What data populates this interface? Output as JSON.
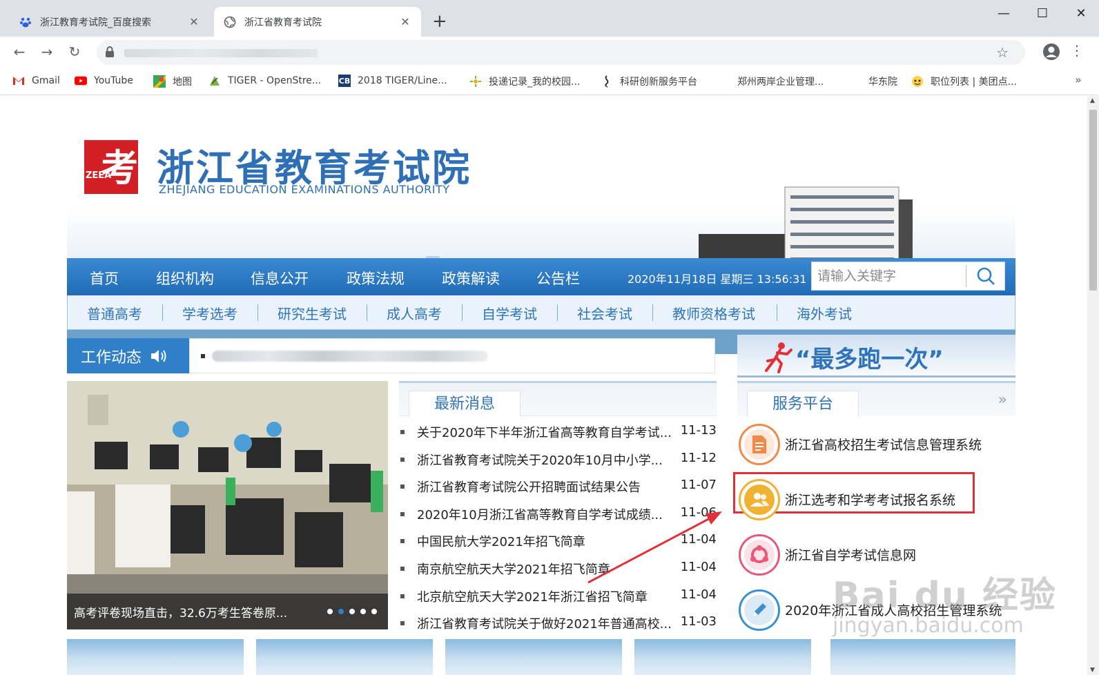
{
  "browser": {
    "tabs": [
      {
        "title": "浙江教育考试院_百度搜索",
        "active": false
      },
      {
        "title": "浙江省教育考试院",
        "active": true
      }
    ],
    "new_tab": "+",
    "window": {
      "minimize": "—",
      "maximize": "☐",
      "close": "✕"
    },
    "nav": {
      "back": "←",
      "forward": "→",
      "reload": "↻"
    },
    "star": "☆",
    "menu": "⋮",
    "bookmarks": [
      {
        "label": "Gmail",
        "icon": "gmail-icon"
      },
      {
        "label": "YouTube",
        "icon": "youtube-icon"
      },
      {
        "label": "地图",
        "icon": "maps-icon"
      },
      {
        "label": "TIGER - OpenStre...",
        "icon": "tiger-icon"
      },
      {
        "label": "2018 TIGER/Line...",
        "icon": "cb-icon"
      },
      {
        "label": "投递记录_我的校园...",
        "icon": "campus-icon"
      },
      {
        "label": "科研创新服务平台",
        "icon": "research-icon"
      },
      {
        "label": "郑州两岸企业管理...",
        "icon": ""
      },
      {
        "label": "华东院",
        "icon": ""
      },
      {
        "label": "职位列表 | 美团点...",
        "icon": "meituan-icon"
      }
    ],
    "bookmarks_more": "»"
  },
  "site": {
    "logo_text": "考",
    "logo_abbr": "ZEEA",
    "title_cn": "浙江省教育考试院",
    "title_en": "ZHEJIANG EDUCATION EXAMINATIONS AUTHORITY",
    "main_nav": [
      "首页",
      "组织机构",
      "信息公开",
      "政策法规",
      "政策解读",
      "公告栏"
    ],
    "clock": "2020年11月18日 星期三 13:56:31",
    "search_placeholder": "请输入关键字",
    "sub_nav": [
      "普通高考",
      "学考选考",
      "研究生考试",
      "成人高考",
      "自学考试",
      "社会考试",
      "教师资格考试",
      "海外考试"
    ],
    "work_label": "工作动态",
    "photo_caption": "高考评卷现场直击，32.6万考生答卷原...",
    "news_title": "最新消息",
    "news": [
      {
        "title": "关于2020年下半年浙江省高等教育自学考试...",
        "date": "11-13"
      },
      {
        "title": "浙江省教育考试院关于2020年10月中小学...",
        "date": "11-12"
      },
      {
        "title": "浙江省教育考试院公开招聘面试结果公告",
        "date": "11-07"
      },
      {
        "title": "2020年10月浙江省高等教育自学考试成绩...",
        "date": "11-06"
      },
      {
        "title": "中国民航大学2021年招飞简章",
        "date": "11-04"
      },
      {
        "title": "南京航空航天大学2021年招飞简章",
        "date": "11-04"
      },
      {
        "title": "北京航空航天大学2021年浙江省招飞简章",
        "date": "11-04"
      },
      {
        "title": "浙江省教育考试院关于做好2021年普通高校...",
        "date": "11-03"
      }
    ],
    "slogan": "“最多跑一次”",
    "services_title": "服务平台",
    "services_more": "»",
    "services": [
      {
        "label": "浙江省高校招生考试信息管理系统",
        "icon": "document-icon",
        "color": "#f08a4b"
      },
      {
        "label": "浙江选考和学考考试报名系统",
        "icon": "users-icon",
        "color": "#f0b232"
      },
      {
        "label": "浙江省自学考试信息网",
        "icon": "network-icon",
        "color": "#e8587a"
      },
      {
        "label": "2020年浙江省成人高校招生管理系统",
        "icon": "pencil-icon",
        "color": "#3a8fd0"
      }
    ]
  },
  "watermark": {
    "line1": "Bai du 经验",
    "line2": "jingyan.baidu.com"
  },
  "colors": {
    "primary": "#2f80c9",
    "highlight": "#e0313a",
    "logo_red": "#d21f26"
  }
}
